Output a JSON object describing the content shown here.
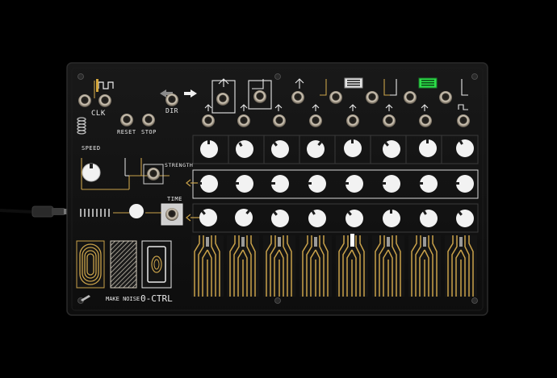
{
  "panel_labels": {
    "clk": "CLK",
    "reset": "RESET",
    "stop": "STOP",
    "dir": "DIR",
    "speed": "SPEED",
    "strength": "STRENGTH",
    "time": "TIME"
  },
  "branding": {
    "maker": "MAKE NOISE",
    "product": "0-CTRL"
  },
  "colors": {
    "panel": "#141414",
    "panel_edge": "#1f1f1f",
    "gold": "#c9a24a",
    "knob": "#f2f2f2",
    "led_green": "#2de04a",
    "jack_metal": "#b9b2a6"
  },
  "knob_rows": [
    {
      "row": "top",
      "count": 8
    },
    {
      "row": "strength",
      "count": 8
    },
    {
      "row": "time",
      "count": 8
    }
  ],
  "touch_plates": 8,
  "cable": "patch-cable"
}
